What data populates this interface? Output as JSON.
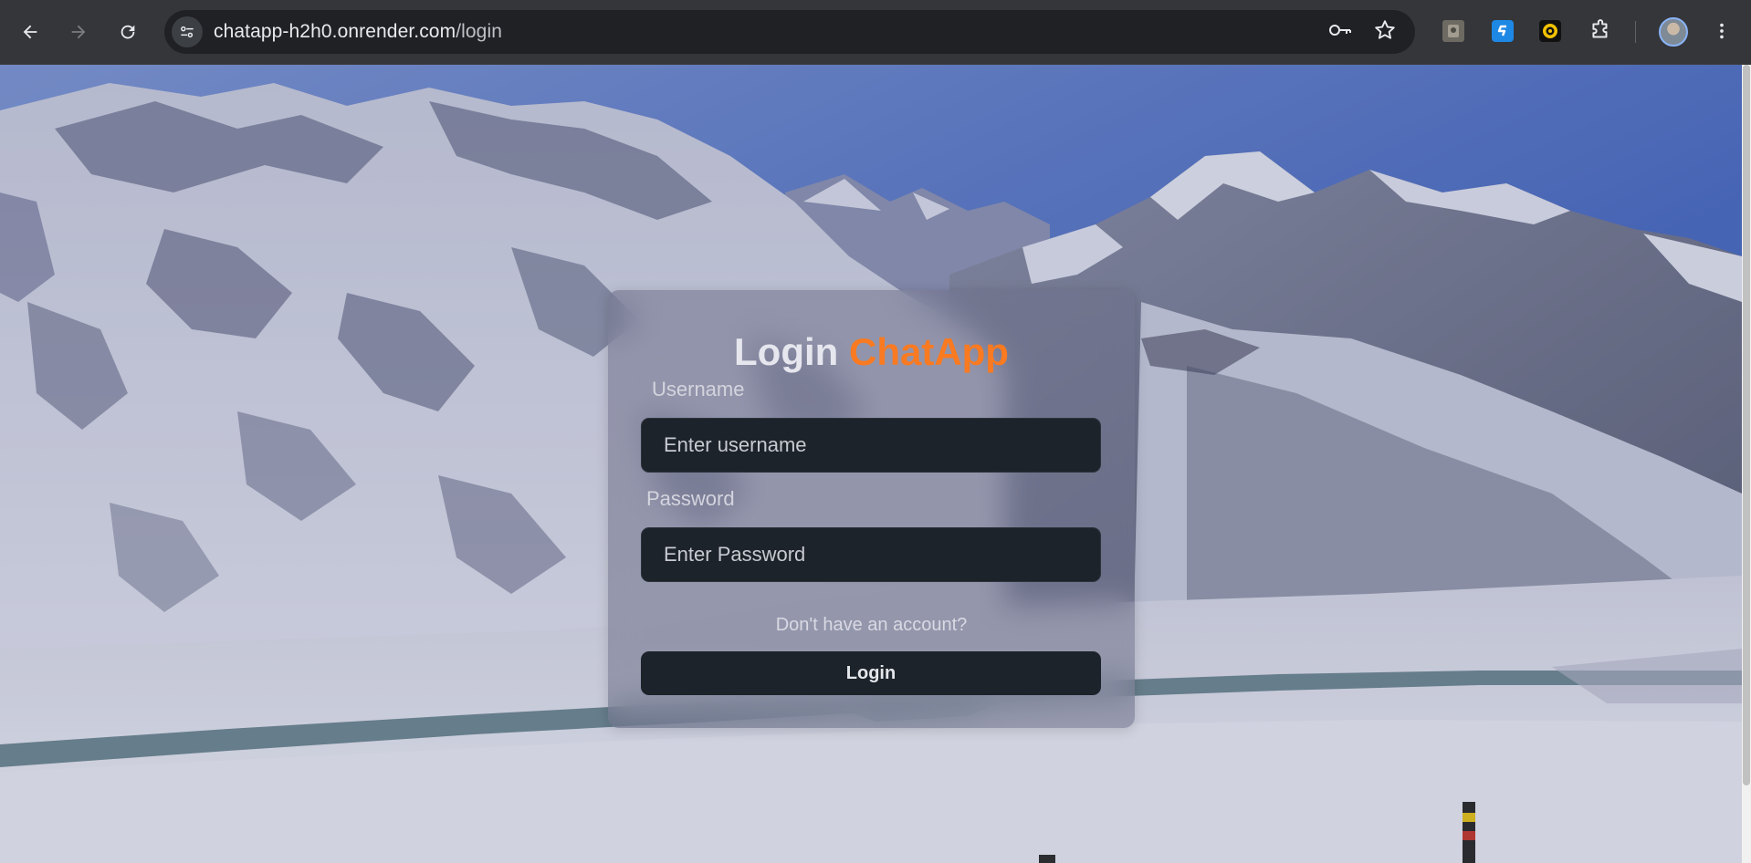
{
  "browser": {
    "url_host": "chatapp-h2h0.onrender.com",
    "url_path": "/login",
    "icons": {
      "back": "arrow-left-icon",
      "forward": "arrow-right-icon",
      "reload": "reload-icon",
      "site_info": "tune-icon",
      "password": "key-icon",
      "bookmark": "star-icon",
      "extensions": "puzzle-icon",
      "menu": "more-vert-icon"
    }
  },
  "login": {
    "title": "Login",
    "brand": "ChatApp",
    "brand_color": "#f97a21",
    "username_label": "Username",
    "username_placeholder": "Enter username",
    "password_label": "Password",
    "password_placeholder": "Enter Password",
    "signup_text": "Don't have an account?",
    "submit_label": "Login"
  }
}
